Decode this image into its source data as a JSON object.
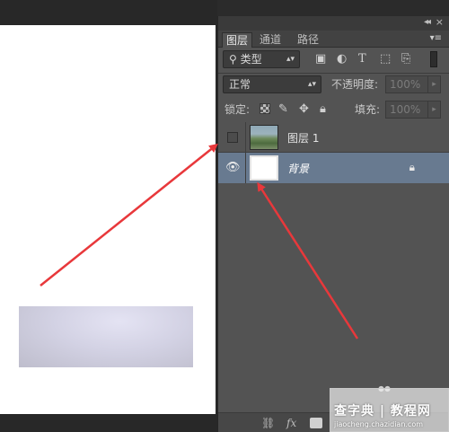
{
  "panel": {
    "tabs": [
      "图层",
      "通道",
      "路径"
    ],
    "filter": {
      "label": "类型",
      "icons": [
        "image-filter-icon",
        "adjustment-filter-icon",
        "type-filter-icon",
        "shape-filter-icon",
        "smart-object-filter-icon"
      ]
    },
    "blend_mode": "正常",
    "opacity_label": "不透明度:",
    "opacity_value": "100%",
    "lock_label": "锁定:",
    "fill_label": "填充:",
    "fill_value": "100%"
  },
  "layers": [
    {
      "name": "图层 1",
      "visible": false,
      "selected": false
    },
    {
      "name": "背景",
      "visible": true,
      "selected": true,
      "locked": true
    }
  ],
  "bottom_icons": [
    "link-icon",
    "fx-icon",
    "mask-icon"
  ],
  "watermark": {
    "main": "查字典 | 教程网",
    "sub": "jiaocheng.chazidian.com"
  },
  "colors": {
    "arrow": "#e8383b",
    "selection": "#687a90",
    "panel_bg": "#535353"
  }
}
